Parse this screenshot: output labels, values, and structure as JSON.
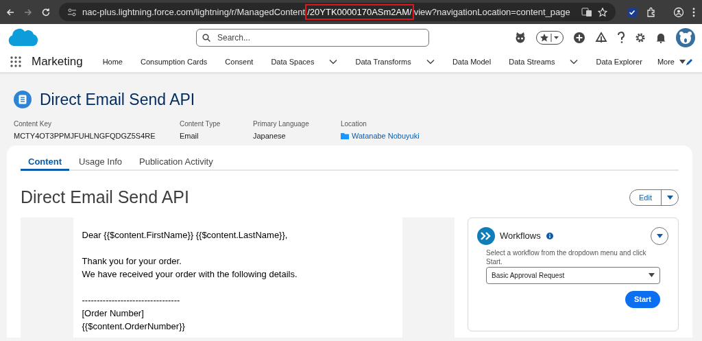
{
  "browser": {
    "url_prefix": "nac-plus.lightning.force.com/lightning/r/ManagedContent",
    "url_highlight": "/20YTK0000170ASm2AM/",
    "url_suffix": "view?navigationLocation=content_page"
  },
  "header": {
    "search_placeholder": "Search..."
  },
  "nav": {
    "app_name": "Marketing",
    "items": [
      {
        "label": "Home",
        "dropdown": false
      },
      {
        "label": "Consumption Cards",
        "dropdown": false
      },
      {
        "label": "Consent",
        "dropdown": false
      },
      {
        "label": "Data Spaces",
        "dropdown": true
      },
      {
        "label": "Data Transforms",
        "dropdown": true
      },
      {
        "label": "Data Model",
        "dropdown": false
      },
      {
        "label": "Data Streams",
        "dropdown": true
      },
      {
        "label": "Data Explorer",
        "dropdown": false
      }
    ],
    "more": "More"
  },
  "record": {
    "title": "Direct Email Send API",
    "fields": [
      {
        "label": "Content Key",
        "value": "MCTY4OT3PPMJFUHLNGFQDGZ5S4RE",
        "kind": "text"
      },
      {
        "label": "Content Type",
        "value": "Email",
        "kind": "text"
      },
      {
        "label": "Primary Language",
        "value": "Japanese",
        "kind": "text"
      },
      {
        "label": "Location",
        "value": "Watanabe Nobuyuki",
        "kind": "folder-link"
      }
    ]
  },
  "tabs": [
    {
      "label": "Content",
      "selected": true
    },
    {
      "label": "Usage Info",
      "selected": false
    },
    {
      "label": "Publication Activity",
      "selected": false
    }
  ],
  "content": {
    "heading": "Direct Email Send API",
    "edit_button": "Edit",
    "email_paragraphs": [
      [
        "Dear {{$content.FirstName}} {{$content.LastName}},"
      ],
      [
        "Thank you for your order.",
        "We have received your order with the following details."
      ],
      [
        "---------------------------------",
        "[Order Number]",
        "{{$content.OrderNumber}}"
      ]
    ]
  },
  "workflows": {
    "title": "Workflows",
    "description": "Select a workflow from the dropdown menu and click Start.",
    "selected_workflow": "Basic Approval Request",
    "start_button": "Start"
  }
}
